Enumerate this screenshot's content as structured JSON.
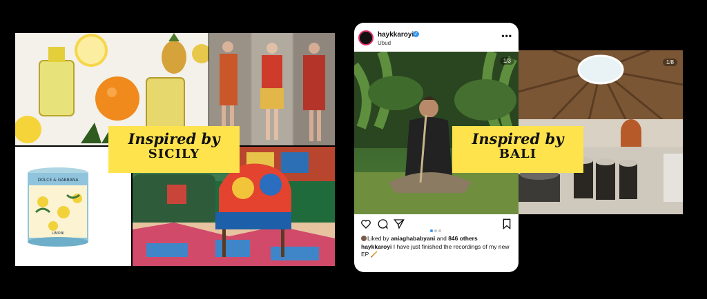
{
  "sicily_banner": {
    "line1": "Inspired by",
    "line2": "SICILY"
  },
  "bali_banner": {
    "line1": "Inspired by",
    "line2": "BALI"
  },
  "candle": {
    "brand": "DOLCE & GABBANA",
    "label": "LIMONI"
  },
  "instagram": {
    "username": "haykkaroyi",
    "location": "Ubud",
    "photo_counter": "1/3",
    "liked_by_prefix": "Liked by ",
    "liked_by_user": "aniaghababyani",
    "liked_by_and": " and ",
    "likes_count": "846 others",
    "caption_user": "haykkaroyi",
    "caption_text": " I have just finished the recordings of my new EP 🪈",
    "carousel_total": 3,
    "carousel_active": 1
  },
  "temple": {
    "photo_counter": "1/8"
  }
}
